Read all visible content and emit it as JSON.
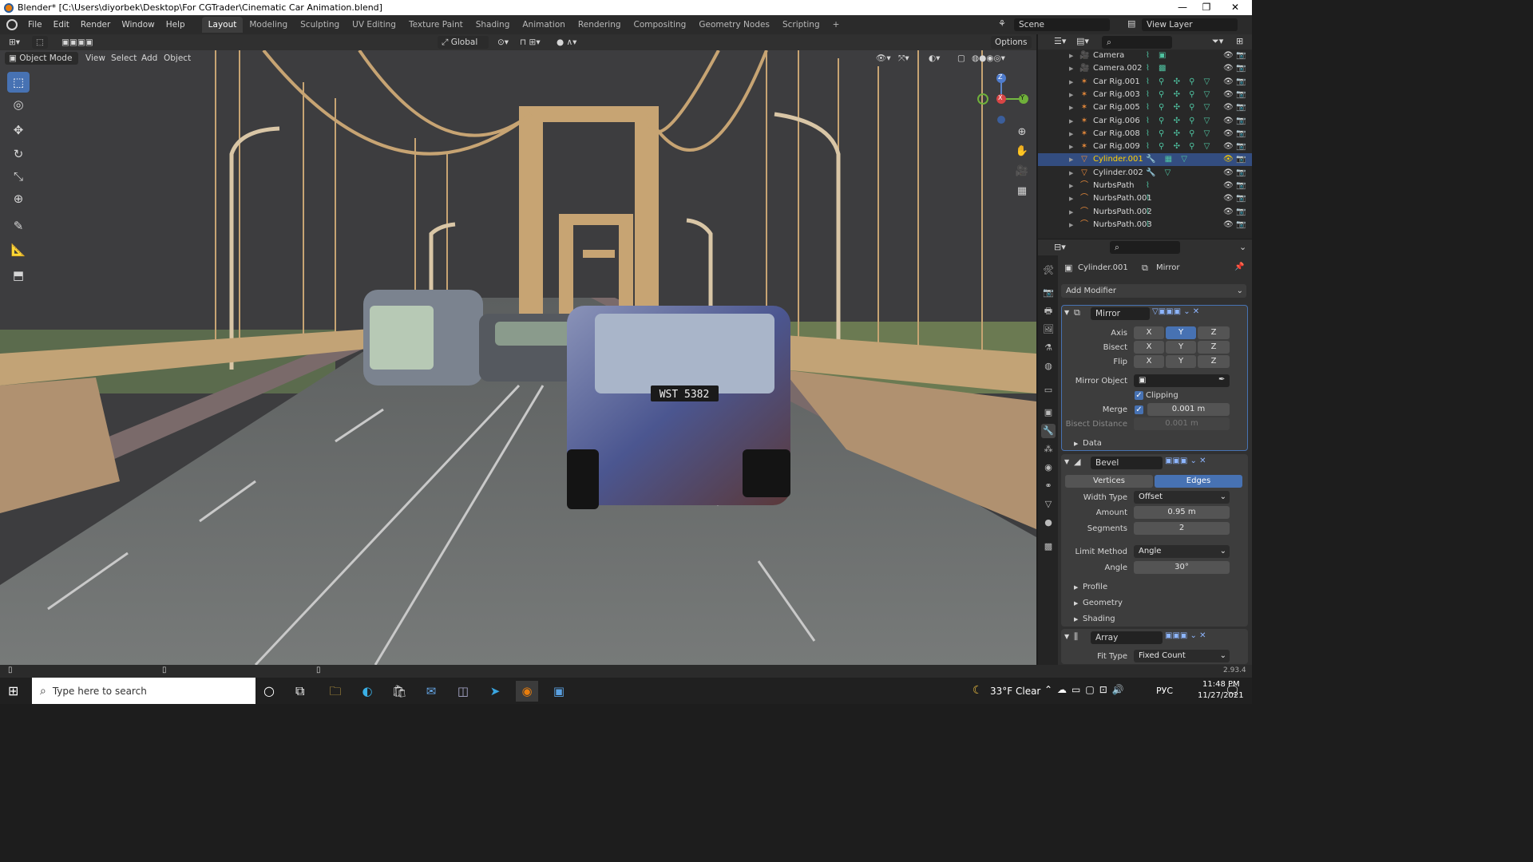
{
  "window": {
    "title": "Blender* [C:\\Users\\diyorbek\\Desktop\\For CGTrader\\Cinematic Car Animation.blend]",
    "minimize": "—",
    "maximize": "❐",
    "close": "✕"
  },
  "menu": [
    "File",
    "Edit",
    "Render",
    "Window",
    "Help"
  ],
  "workspaces": [
    "Layout",
    "Modeling",
    "Sculpting",
    "UV Editing",
    "Texture Paint",
    "Shading",
    "Animation",
    "Rendering",
    "Compositing",
    "Geometry Nodes",
    "Scripting",
    "+"
  ],
  "active_workspace": "Layout",
  "scene": {
    "label": "Scene",
    "view_layer": "View Layer"
  },
  "viewport": {
    "mode": "Object Mode",
    "menus": [
      "View",
      "Select",
      "Add",
      "Object"
    ],
    "orientation": "Global",
    "options": "Options",
    "gizmo": {
      "x": "X",
      "y": "Y",
      "z": "Z"
    },
    "license_plate": "WST 5382"
  },
  "outliner": {
    "rows": [
      {
        "name": "Camera",
        "icon": "camera-icon",
        "mods": "⌇ ▣"
      },
      {
        "name": "Camera.002",
        "icon": "camera-icon",
        "mods": "⌇ ▩"
      },
      {
        "name": "Car Rig.001",
        "icon": "armature-icon",
        "mods": "⌇ ⚲ ✣ ⚲ ▽"
      },
      {
        "name": "Car Rig.003",
        "icon": "armature-icon",
        "mods": "⌇ ⚲ ✣ ⚲ ▽"
      },
      {
        "name": "Car Rig.005",
        "icon": "armature-icon",
        "mods": "⌇ ⚲ ✣ ⚲ ▽"
      },
      {
        "name": "Car Rig.006",
        "icon": "armature-icon",
        "mods": "⌇ ⚲ ✣ ⚲ ▽"
      },
      {
        "name": "Car Rig.008",
        "icon": "armature-icon",
        "mods": "⌇ ⚲ ✣ ⚲ ▽"
      },
      {
        "name": "Car Rig.009",
        "icon": "armature-icon",
        "mods": "⌇ ⚲ ✣ ⚲ ▽"
      },
      {
        "name": "Cylinder.001",
        "icon": "mesh-icon",
        "mods": "🔧 ▦ ▽"
      },
      {
        "name": "Cylinder.002",
        "icon": "mesh-icon",
        "mods": "🔧 ▽"
      },
      {
        "name": "NurbsPath",
        "icon": "curve-icon",
        "mods": "⌇"
      },
      {
        "name": "NurbsPath.001",
        "icon": "curve-icon",
        "mods": "⌇"
      },
      {
        "name": "NurbsPath.002",
        "icon": "curve-icon",
        "mods": "⌇"
      },
      {
        "name": "NurbsPath.003",
        "icon": "curve-icon",
        "mods": "⌇"
      }
    ],
    "selected": "Cylinder.001"
  },
  "properties": {
    "object": "Cylinder.001",
    "modifier_context": "Mirror",
    "add_modifier": "Add Modifier",
    "mirror": {
      "name": "Mirror",
      "axis_label": "Axis",
      "bisect_label": "Bisect",
      "flip_label": "Flip",
      "x": "X",
      "y": "Y",
      "z": "Z",
      "mirror_object_label": "Mirror Object",
      "clipping_label": "Clipping",
      "merge_label": "Merge",
      "merge_value": "0.001 m",
      "bisect_distance_label": "Bisect Distance",
      "bisect_distance_value": "0.001 m",
      "data_label": "Data"
    },
    "bevel": {
      "name": "Bevel",
      "vertices": "Vertices",
      "edges": "Edges",
      "width_type_label": "Width Type",
      "width_type_value": "Offset",
      "amount_label": "Amount",
      "amount_value": "0.95 m",
      "segments_label": "Segments",
      "segments_value": "2",
      "limit_method_label": "Limit Method",
      "limit_method_value": "Angle",
      "angle_label": "Angle",
      "angle_value": "30°",
      "profile": "Profile",
      "geometry": "Geometry",
      "shading": "Shading"
    },
    "array": {
      "name": "Array",
      "fit_type_label": "Fit Type",
      "fit_type_value": "Fixed Count"
    }
  },
  "status": {
    "version": "2.93.4"
  },
  "taskbar": {
    "search_placeholder": "Type here to search",
    "weather": "33°F  Clear",
    "language": "РУС",
    "time": "11:48 PM",
    "date": "11/27/2021"
  }
}
